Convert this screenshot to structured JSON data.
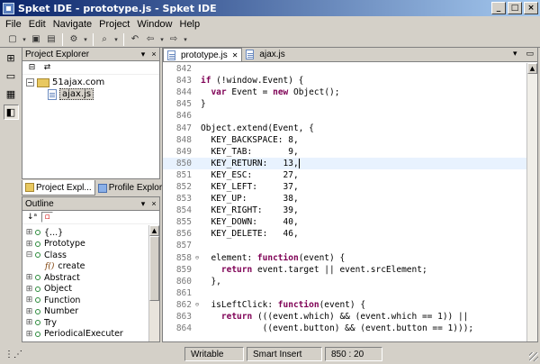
{
  "window": {
    "title": "Spket IDE - prototype.js - Spket IDE"
  },
  "menu": [
    "File",
    "Edit",
    "Navigate",
    "Project",
    "Window",
    "Help"
  ],
  "project_explorer": {
    "title": "Project Explorer",
    "tree": [
      {
        "label": "51ajax.com",
        "kind": "folder",
        "expanded": true
      },
      {
        "label": "ajax.js",
        "kind": "file",
        "selected": true
      }
    ]
  },
  "bottom_tabs": [
    {
      "label": "Project Expl...",
      "active": true
    },
    {
      "label": "Profile Explorer",
      "active": false
    }
  ],
  "outline": {
    "title": "Outline",
    "items": [
      {
        "label": "{...}",
        "expandable": true,
        "kind": "field"
      },
      {
        "label": "Prototype",
        "expandable": true,
        "kind": "field"
      },
      {
        "label": "Class",
        "expandable": true,
        "expanded": true,
        "kind": "field"
      },
      {
        "label": "create",
        "expandable": false,
        "kind": "function",
        "indent": true
      },
      {
        "label": "Abstract",
        "expandable": true,
        "kind": "field"
      },
      {
        "label": "Object",
        "expandable": true,
        "kind": "field"
      },
      {
        "label": "Function",
        "expandable": true,
        "kind": "field"
      },
      {
        "label": "Number",
        "expandable": true,
        "kind": "field"
      },
      {
        "label": "Try",
        "expandable": true,
        "kind": "field"
      },
      {
        "label": "PeriodicalExecuter",
        "expandable": true,
        "kind": "field"
      }
    ]
  },
  "editor": {
    "tabs": [
      {
        "label": "prototype.js",
        "active": true,
        "closable": true
      },
      {
        "label": "ajax.js",
        "active": false,
        "closable": false
      }
    ],
    "current_line": 850,
    "lines": [
      {
        "n": 842,
        "code": ""
      },
      {
        "n": 843,
        "code": "if (!window.Event) {"
      },
      {
        "n": 844,
        "code": "  var Event = new Object();"
      },
      {
        "n": 845,
        "code": "}"
      },
      {
        "n": 846,
        "code": ""
      },
      {
        "n": 847,
        "code": "Object.extend(Event, {"
      },
      {
        "n": 848,
        "code": "  KEY_BACKSPACE: 8,"
      },
      {
        "n": 849,
        "code": "  KEY_TAB:       9,"
      },
      {
        "n": 850,
        "code": "  KEY_RETURN:   13,"
      },
      {
        "n": 851,
        "code": "  KEY_ESC:      27,"
      },
      {
        "n": 852,
        "code": "  KEY_LEFT:     37,"
      },
      {
        "n": 853,
        "code": "  KEY_UP:       38,"
      },
      {
        "n": 854,
        "code": "  KEY_RIGHT:    39,"
      },
      {
        "n": 855,
        "code": "  KEY_DOWN:     40,"
      },
      {
        "n": 856,
        "code": "  KEY_DELETE:   46,"
      },
      {
        "n": 857,
        "code": ""
      },
      {
        "n": 858,
        "code": "  element: function(event) {",
        "fold": true
      },
      {
        "n": 859,
        "code": "    return event.target || event.srcElement;"
      },
      {
        "n": 860,
        "code": "  },"
      },
      {
        "n": 861,
        "code": ""
      },
      {
        "n": 862,
        "code": "  isLeftClick: function(event) {",
        "fold": true
      },
      {
        "n": 863,
        "code": "    return (((event.which) && (event.which == 1)) ||"
      },
      {
        "n": 864,
        "code": "            ((event.button) && (event.button == 1)));"
      }
    ]
  },
  "statusbar": {
    "mode": "Writable",
    "insert": "Smart Insert",
    "position": "850 : 20"
  }
}
